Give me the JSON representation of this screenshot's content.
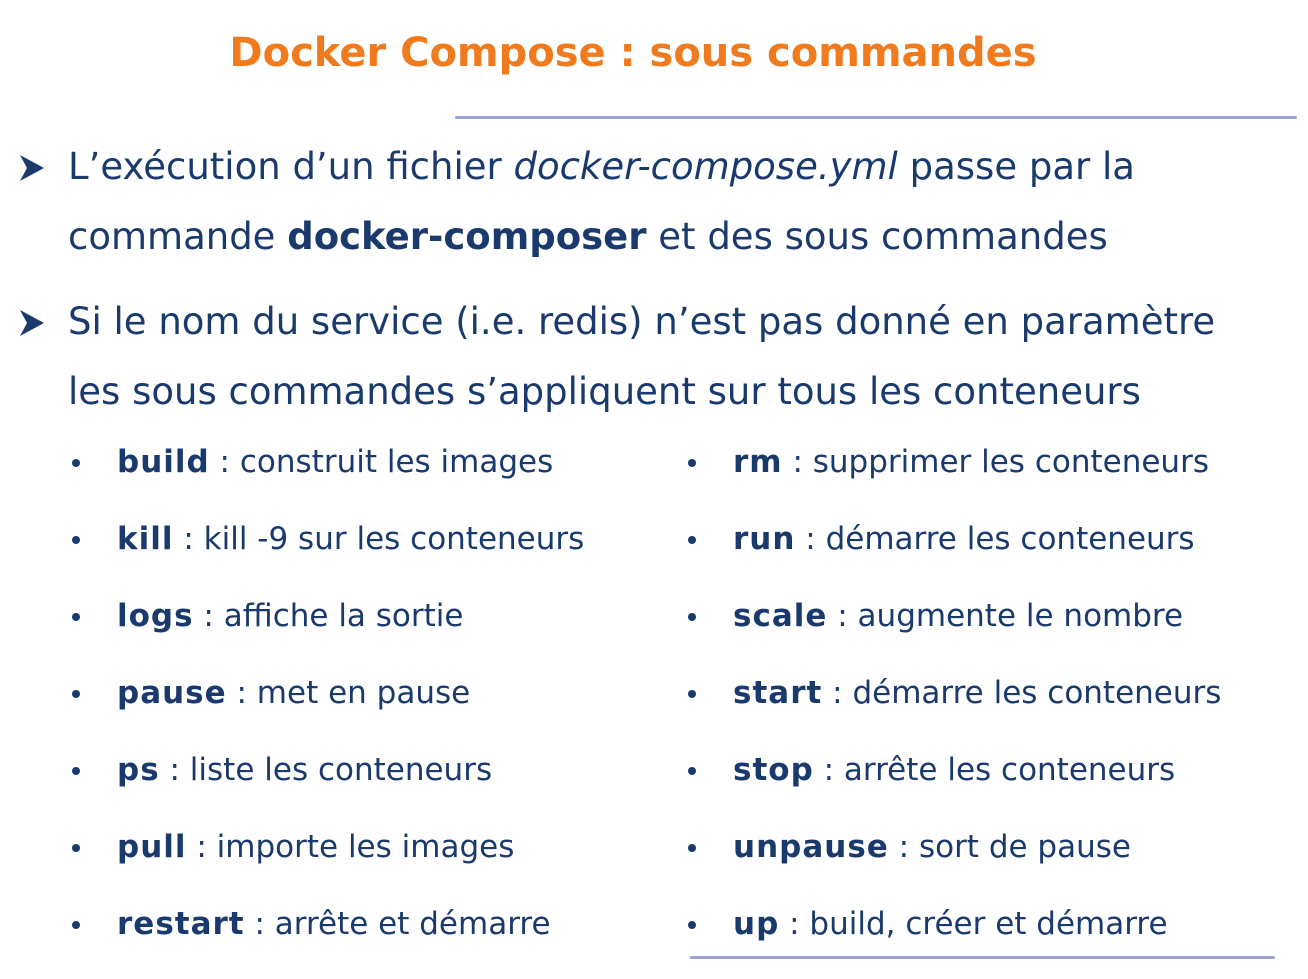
{
  "title": "Docker Compose : sous commandes",
  "bullets": [
    {
      "line1_pre": "L’exécution d’un fichier ",
      "line1_italic": "docker-compose.yml",
      "line1_post": " passe par la",
      "line2_pre": "commande ",
      "line2_bold": "docker-composer",
      "line2_post": " et des sous commandes"
    },
    {
      "line1": "Si le nom du service (i.e. redis) n’est pas donné en paramètre",
      "line2": "les sous commandes s’appliquent sur tous les conteneurs"
    }
  ],
  "commands_left": [
    {
      "cmd": "build",
      "desc": " : construit les images"
    },
    {
      "cmd": "kill",
      "desc": " : kill -9 sur les conteneurs"
    },
    {
      "cmd": "logs",
      "desc": " : affiche la sortie"
    },
    {
      "cmd": "pause",
      "desc": " : met en pause"
    },
    {
      "cmd": "ps",
      "desc": " : liste les conteneurs"
    },
    {
      "cmd": "pull",
      "desc": " : importe les images"
    },
    {
      "cmd": "restart",
      "desc": " : arrête et démarre"
    }
  ],
  "commands_right": [
    {
      "cmd": "rm",
      "desc": " : supprimer les conteneurs"
    },
    {
      "cmd": "run",
      "desc": " : démarre les conteneurs"
    },
    {
      "cmd": "scale",
      "desc": " : augmente le nombre"
    },
    {
      "cmd": "start",
      "desc": " : démarre les conteneurs"
    },
    {
      "cmd": "stop",
      "desc": " : arrête les conteneurs"
    },
    {
      "cmd": "unpause",
      "desc": " : sort de pause"
    },
    {
      "cmd": "up",
      "desc": " : build, créer et démarre"
    }
  ],
  "colors": {
    "title": "#f07a1e",
    "text": "#1a3a6e",
    "rule": "#9aa3d4"
  },
  "icons": {
    "bullet_marker": "chevron-right-icon",
    "list_marker": "dot-icon"
  }
}
